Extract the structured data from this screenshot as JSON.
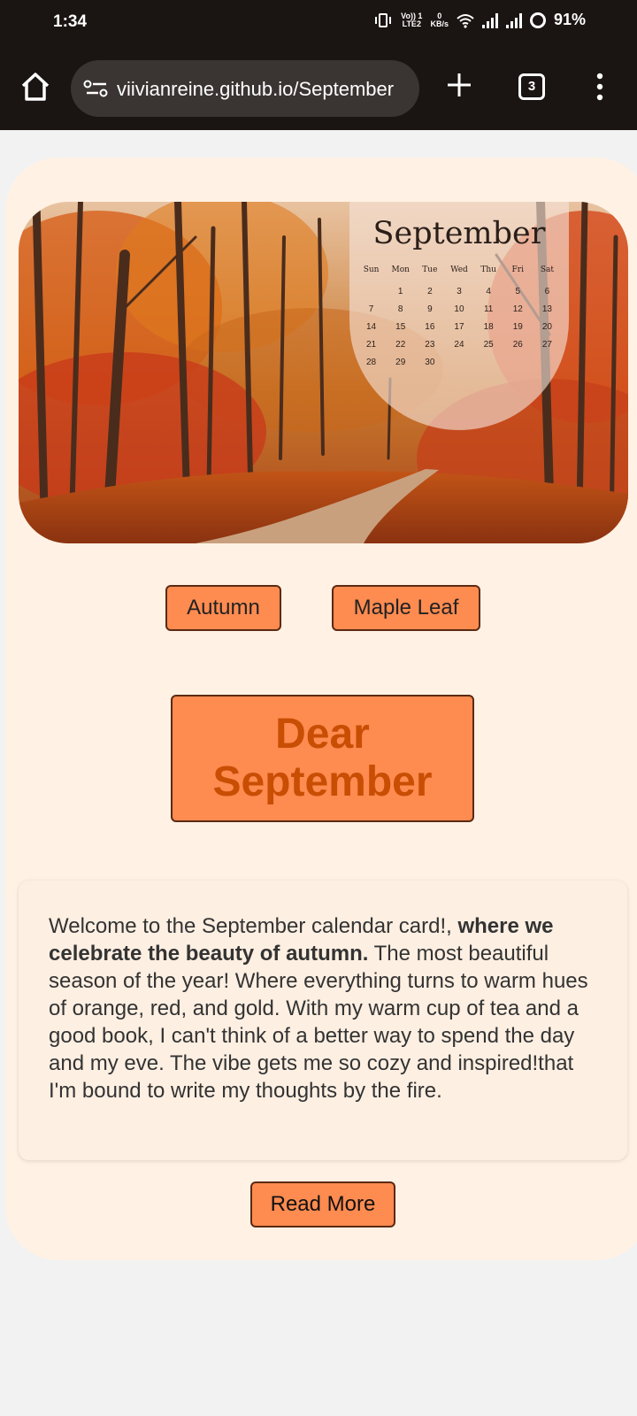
{
  "status_bar": {
    "time": "1:34",
    "volte_line1": "Vo)) 1",
    "volte_line2": "LTE2",
    "speed_value": "0",
    "speed_unit": "KB/s",
    "battery": "91%"
  },
  "browser": {
    "url": "viivianreine.github.io/September",
    "tab_count": "3"
  },
  "hero": {
    "calendar_title": "September",
    "weekdays": [
      "Sun",
      "Mon",
      "Tue",
      "Wed",
      "Thu",
      "Fri",
      "Sat"
    ],
    "dates": [
      "",
      "1",
      "2",
      "3",
      "4",
      "5",
      "6",
      "7",
      "8",
      "9",
      "10",
      "11",
      "12",
      "13",
      "14",
      "15",
      "16",
      "17",
      "18",
      "19",
      "20",
      "21",
      "22",
      "23",
      "24",
      "25",
      "26",
      "27",
      "28",
      "29",
      "30"
    ]
  },
  "tags": {
    "autumn": "Autumn",
    "maple_leaf": "Maple Leaf"
  },
  "title": {
    "line1": "Dear",
    "line2": "September"
  },
  "body": {
    "intro": "Welcome to the September calendar card!, ",
    "emphasis": "where we celebrate the beauty of autumn.",
    "rest": " The most beautiful season of the year! Where everything turns to warm hues of orange, red, and gold. With my warm cup of tea and a good book, I can't think of a better way to spend the day and my eve. The vibe gets me so cozy and inspired!that I'm bound to write my thoughts by the fire."
  },
  "read_more": "Read More",
  "colors": {
    "card_bg": "#fff1e4",
    "button_bg": "#fe8b50",
    "button_border": "#5a2a12",
    "title_text": "#c84e04"
  }
}
